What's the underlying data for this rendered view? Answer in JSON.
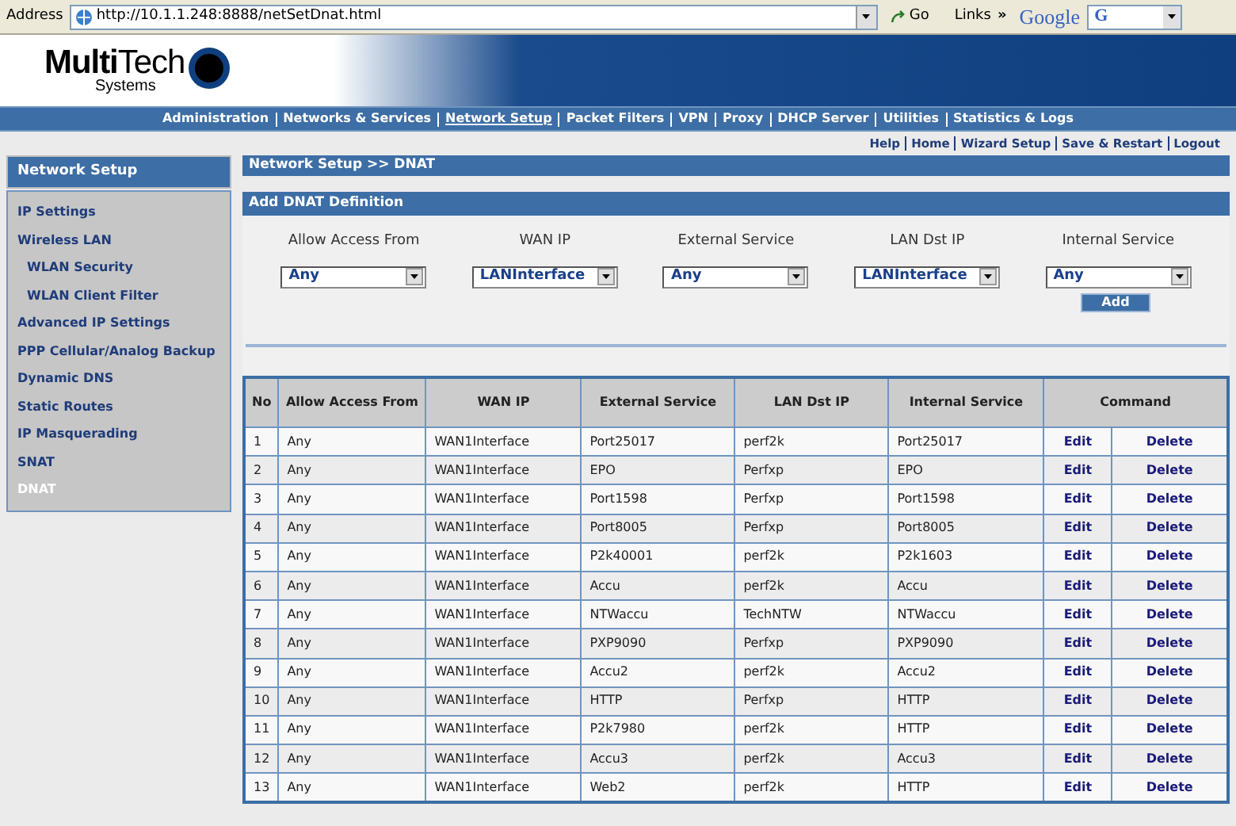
{
  "address_bar": {
    "label": "Address",
    "url": "http://10.1.1.248:8888/netSetDnat.html",
    "go": "Go",
    "links": "Links",
    "more": "»",
    "search_brand": "Google",
    "search_logo": "G"
  },
  "logo": {
    "brand_a": "Multi",
    "brand_b": "Tech",
    "subtitle": "Systems"
  },
  "nav": [
    {
      "label": "Administration",
      "selected": false
    },
    {
      "label": "Networks & Services",
      "selected": false
    },
    {
      "label": "Network Setup",
      "selected": true
    },
    {
      "label": "Packet Filters",
      "selected": false
    },
    {
      "label": "VPN",
      "selected": false
    },
    {
      "label": "Proxy",
      "selected": false
    },
    {
      "label": "DHCP Server",
      "selected": false
    },
    {
      "label": "Utilities",
      "selected": false
    },
    {
      "label": "Statistics & Logs",
      "selected": false
    }
  ],
  "utility_links": [
    "Help",
    "Home",
    "Wizard Setup",
    "Save & Restart",
    "Logout"
  ],
  "sidebar": {
    "title": "Network Setup",
    "items": [
      {
        "label": "IP Settings",
        "selected": false
      },
      {
        "label": "Wireless LAN",
        "selected": false,
        "children": [
          {
            "label": "WLAN Security",
            "selected": false
          },
          {
            "label": "WLAN Client Filter",
            "selected": false
          }
        ]
      },
      {
        "label": "Advanced IP Settings",
        "selected": false
      },
      {
        "label": "PPP Cellular/Analog Backup",
        "selected": false
      },
      {
        "label": "Dynamic DNS",
        "selected": false
      },
      {
        "label": "Static Routes",
        "selected": false
      },
      {
        "label": "IP Masquerading",
        "selected": false
      },
      {
        "label": "SNAT",
        "selected": false
      },
      {
        "label": "DNAT",
        "selected": true
      }
    ]
  },
  "breadcrumb": "Network Setup >> DNAT",
  "form": {
    "title": "Add DNAT Definition",
    "fields": [
      {
        "label": "Allow Access From",
        "value": "Any"
      },
      {
        "label": "WAN IP",
        "value": "LANInterface"
      },
      {
        "label": "External Service",
        "value": "Any"
      },
      {
        "label": "LAN Dst IP",
        "value": "LANInterface"
      },
      {
        "label": "Internal Service",
        "value": "Any"
      }
    ],
    "add_button": "Add"
  },
  "table": {
    "columns": [
      "No",
      "Allow Access From",
      "WAN IP",
      "External Service",
      "LAN Dst IP",
      "Internal Service",
      "Command"
    ],
    "rows": [
      {
        "cells": [
          "1",
          "Any",
          "WAN1Interface",
          "Port25017",
          "perf2k",
          "Port25017"
        ],
        "edit": "Edit",
        "delete": "Delete"
      },
      {
        "cells": [
          "2",
          "Any",
          "WAN1Interface",
          "EPO",
          "Perfxp",
          "EPO"
        ],
        "edit": "Edit",
        "delete": "Delete"
      },
      {
        "cells": [
          "3",
          "Any",
          "WAN1Interface",
          "Port1598",
          "Perfxp",
          "Port1598"
        ],
        "edit": "Edit",
        "delete": "Delete"
      },
      {
        "cells": [
          "4",
          "Any",
          "WAN1Interface",
          "Port8005",
          "Perfxp",
          "Port8005"
        ],
        "edit": "Edit",
        "delete": "Delete"
      },
      {
        "cells": [
          "5",
          "Any",
          "WAN1Interface",
          "P2k40001",
          "perf2k",
          "P2k1603"
        ],
        "edit": "Edit",
        "delete": "Delete"
      },
      {
        "cells": [
          "6",
          "Any",
          "WAN1Interface",
          "Accu",
          "perf2k",
          "Accu"
        ],
        "edit": "Edit",
        "delete": "Delete"
      },
      {
        "cells": [
          "7",
          "Any",
          "WAN1Interface",
          "NTWaccu",
          "TechNTW",
          "NTWaccu"
        ],
        "edit": "Edit",
        "delete": "Delete"
      },
      {
        "cells": [
          "8",
          "Any",
          "WAN1Interface",
          "PXP9090",
          "Perfxp",
          "PXP9090"
        ],
        "edit": "Edit",
        "delete": "Delete"
      },
      {
        "cells": [
          "9",
          "Any",
          "WAN1Interface",
          "Accu2",
          "perf2k",
          "Accu2"
        ],
        "edit": "Edit",
        "delete": "Delete"
      },
      {
        "cells": [
          "10",
          "Any",
          "WAN1Interface",
          "HTTP",
          "Perfxp",
          "HTTP"
        ],
        "edit": "Edit",
        "delete": "Delete"
      },
      {
        "cells": [
          "11",
          "Any",
          "WAN1Interface",
          "P2k7980",
          "perf2k",
          "HTTP"
        ],
        "edit": "Edit",
        "delete": "Delete"
      },
      {
        "cells": [
          "12",
          "Any",
          "WAN1Interface",
          "Accu3",
          "perf2k",
          "Accu3"
        ],
        "edit": "Edit",
        "delete": "Delete"
      },
      {
        "cells": [
          "13",
          "Any",
          "WAN1Interface",
          "Web2",
          "perf2k",
          "HTTP"
        ],
        "edit": "Edit",
        "delete": "Delete"
      }
    ]
  }
}
